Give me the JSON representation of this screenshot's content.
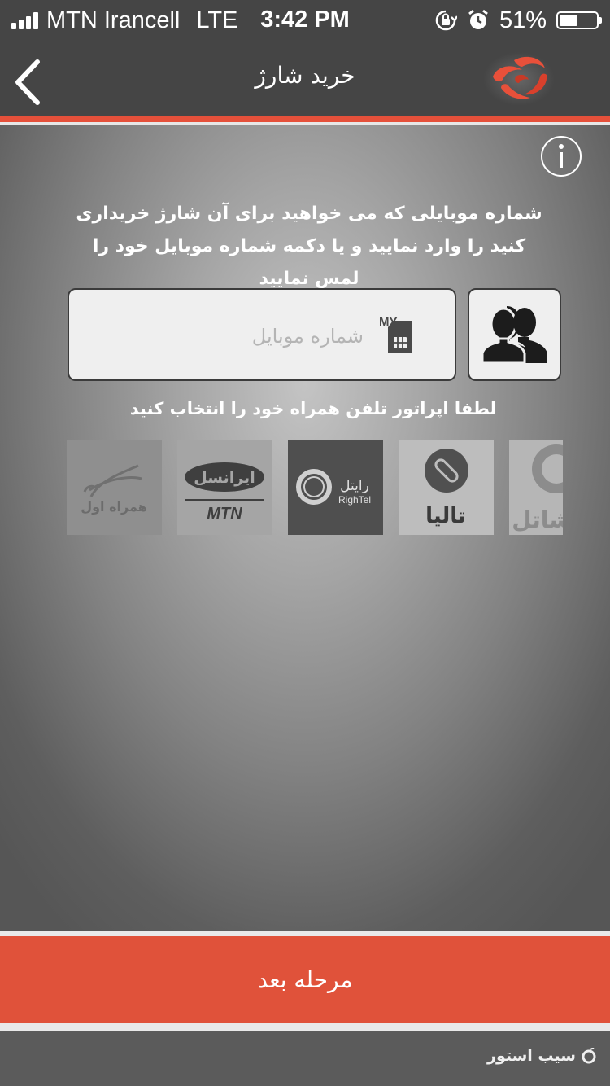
{
  "status_bar": {
    "carrier": "MTN Irancell",
    "network": "LTE",
    "time": "3:42 PM",
    "battery_percent": "51%",
    "battery_level": 0.51,
    "icons": [
      "signal-bars-icon",
      "rotation-lock-icon",
      "alarm-icon",
      "battery-icon"
    ]
  },
  "nav": {
    "title": "خرید شارژ",
    "back_icon": "chevron-left-icon",
    "logo": "app-logo"
  },
  "form": {
    "instruction": "شماره موبایلی که می خواهید برای آن شارژ خریداری کنید را وارد نمایید و یا دکمه شماره موبایل خود را لمس نمایید",
    "phone_placeholder": "شماره موبایل",
    "phone_value": "",
    "sim_badge": "MY",
    "operator_prompt": "لطفا اپراتور تلفن همراه خود را انتخاب کنید"
  },
  "operators": [
    {
      "id": "hamrah-aval",
      "text": "همراه اول",
      "selected": false
    },
    {
      "id": "irancell",
      "text": "ایرانسل",
      "subtext": "MTN",
      "selected": false
    },
    {
      "id": "rightel",
      "text": "رایتل",
      "subtext": "RighTel",
      "selected": true
    },
    {
      "id": "talia",
      "text": "تالیا",
      "selected": false
    },
    {
      "id": "shatel",
      "text": "شاتل",
      "selected": false
    }
  ],
  "colors": {
    "accent": "#e0523a",
    "header": "#454545",
    "field": "#efefef"
  },
  "next_button": "مرحله بعد",
  "watermark": "سیب استور"
}
